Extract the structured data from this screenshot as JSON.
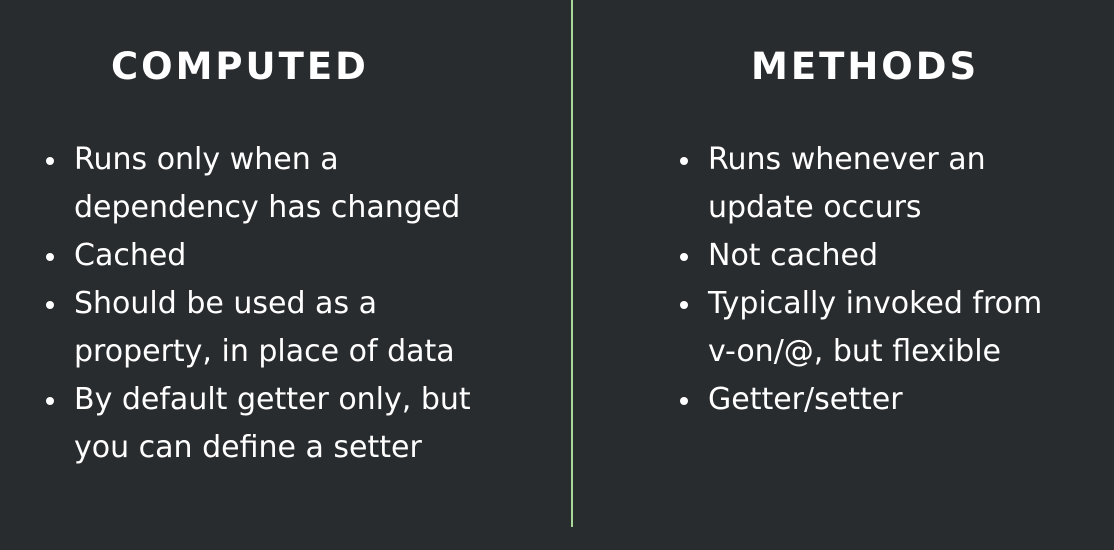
{
  "colors": {
    "background": "#292c2f",
    "text": "#ffffff",
    "divider": "#a9d79a"
  },
  "left": {
    "title": "COMPUTED",
    "items": [
      {
        "lines": [
          "Runs only when a",
          "dependency has changed"
        ]
      },
      {
        "lines": [
          "Cached"
        ]
      },
      {
        "lines": [
          "Should be used as a",
          "property, in place of data"
        ]
      },
      {
        "lines": [
          "By default getter only, but",
          "you can define a setter"
        ]
      }
    ]
  },
  "right": {
    "title": "METHODS",
    "items": [
      {
        "lines": [
          "Runs whenever an",
          "update occurs"
        ]
      },
      {
        "lines": [
          "Not cached"
        ]
      },
      {
        "lines": [
          "Typically invoked from",
          "v-on/@, but flexible"
        ]
      },
      {
        "lines": [
          "Getter/setter"
        ]
      }
    ]
  }
}
